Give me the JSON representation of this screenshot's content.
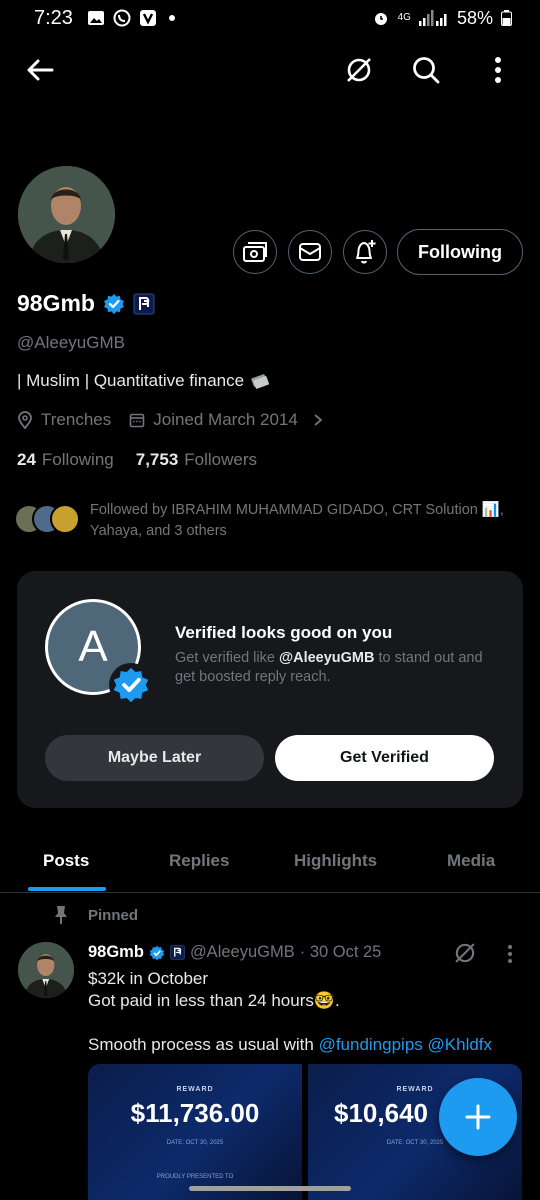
{
  "status_bar": {
    "time": "7:23",
    "network": "4G",
    "battery": "58%"
  },
  "profile": {
    "display_name": "98Gmb",
    "handle": "@AleeyuGMB",
    "bio": "| Muslim | Quantitative finance",
    "location": "Trenches",
    "joined": "Joined March 2014",
    "following_count": "24",
    "following_label": "Following",
    "followers_count": "7,753",
    "followers_label": "Followers",
    "follow_button": "Following",
    "followed_by": "Followed by IBRAHIM MUHAMMAD GIDADO, CRT Solution 📊, Yahaya, and 3 others"
  },
  "verified_card": {
    "avatar_letter": "A",
    "title": "Verified looks good on you",
    "sub_before": "Get verified like ",
    "sub_handle": "@AleeyuGMB",
    "sub_after": " to stand out and get boosted reply reach.",
    "later_button": "Maybe Later",
    "verify_button": "Get Verified"
  },
  "tabs": [
    {
      "label": "Posts"
    },
    {
      "label": "Replies"
    },
    {
      "label": "Highlights"
    },
    {
      "label": "Media"
    }
  ],
  "post": {
    "pinned_label": "Pinned",
    "name": "98Gmb",
    "handle": "@AleeyuGMB",
    "date": "· 30 Oct 25",
    "line1": "$32k in October",
    "line2": "Got paid in less than 24 hours🤓.",
    "line3_prefix": "Smooth process as usual with ",
    "mention1": "@fundingpips",
    "mention2": "@Khldfx",
    "media": [
      {
        "reward_label": "REWARD",
        "amount": "$11,736.00",
        "date": "DATE: OCT 30, 2025",
        "presented": "PROUDLY PRESENTED TO"
      },
      {
        "reward_label": "REWARD",
        "amount": "$10,640",
        "date": "DATE: OCT 30, 2025",
        "presented": ""
      }
    ]
  },
  "colors": {
    "accent": "#1d9bf0",
    "background": "#000000",
    "card": "#16181c",
    "muted": "#71767b"
  },
  "icons": [
    "back-arrow-icon",
    "grok-icon",
    "search-icon",
    "more-vertical-icon",
    "tip-jar-icon",
    "message-icon",
    "notification-add-icon",
    "verified-badge-icon",
    "affiliate-badge-icon",
    "location-icon",
    "calendar-icon",
    "chevron-right-icon",
    "pin-icon",
    "compose-plus-icon"
  ]
}
